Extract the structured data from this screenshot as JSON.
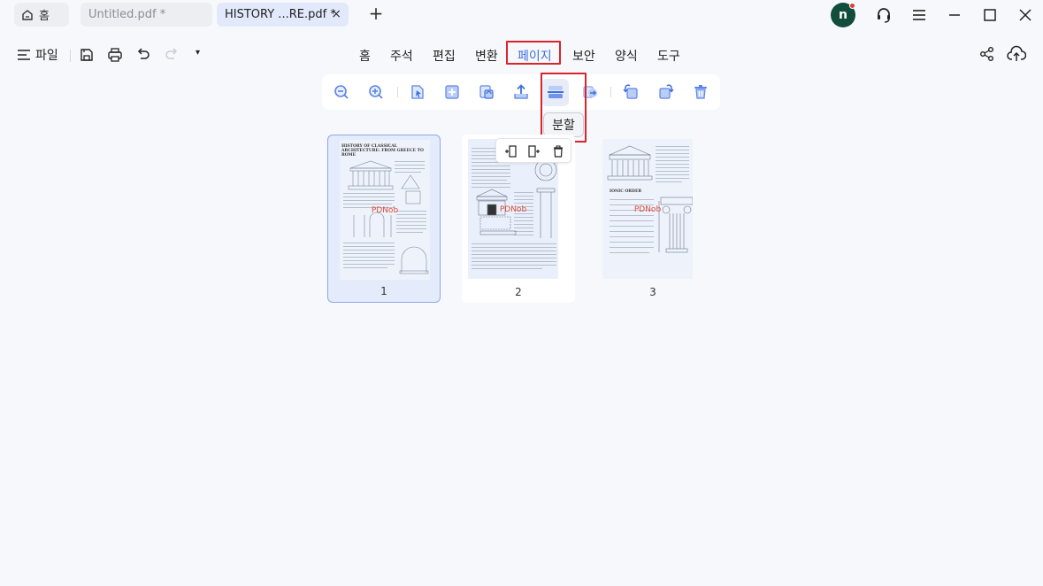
{
  "tabs": {
    "home_label": "홈",
    "untitled_label": "Untitled.pdf *",
    "active_label": "HISTORY ...RE.pdf *",
    "close_glyph": "×",
    "add_glyph": "+"
  },
  "user": {
    "avatar_initial": "n"
  },
  "toolbar": {
    "file_label": "파일",
    "caret": "▾"
  },
  "nav": {
    "home": "홈",
    "comment": "주석",
    "edit": "편집",
    "convert": "변환",
    "page": "페이지",
    "security": "보안",
    "form": "양식",
    "tools": "도구"
  },
  "page_tools": {
    "tooltip": "분할",
    "icons": [
      "zoom-out-icon",
      "zoom-in-icon",
      "select-page-icon",
      "insert-page-icon",
      "replace-page-icon",
      "extract-page-icon",
      "split-page-icon",
      "move-page-icon",
      "rotate-left-icon",
      "rotate-right-icon",
      "delete-page-icon"
    ]
  },
  "thumbnails": [
    {
      "number": "1",
      "title": "HISTORY OF CLASSICAL ARCHITECTURE: FROM GREECE TO ROME",
      "watermark": "PDNob"
    },
    {
      "number": "2",
      "watermark": "PDNob"
    },
    {
      "number": "3",
      "title": "IONIC ORDER",
      "watermark": "PDNob"
    }
  ],
  "colors": {
    "accent": "#3d6fe0",
    "highlight": "#d9232d",
    "avatar_bg": "#124d3c"
  }
}
